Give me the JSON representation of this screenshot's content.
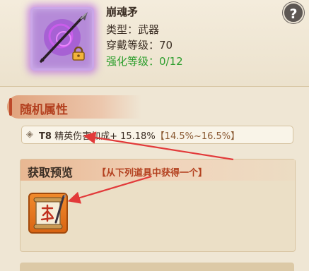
{
  "item": {
    "name": "崩魂矛",
    "type_line": "类型：武器",
    "level_line": "穿戴等级：70",
    "enhance_line": "强化等级：0/12",
    "icon": "spear-icon",
    "locked": true
  },
  "help": {
    "label": "?"
  },
  "random_attr": {
    "title": "随机属性",
    "entry": {
      "tier": "T8",
      "name": "精英伤害加成",
      "value": "+ 15.18%",
      "range": "【14.5%~16.5%】"
    }
  },
  "obtain": {
    "title": "获取预览",
    "subtitle": "【从下列道具中获得一个】",
    "items": [
      {
        "icon": "scroll-icon"
      }
    ]
  },
  "colors": {
    "accent": "#b3401f",
    "enhance_green": "#2d9e2d",
    "epic_purple": "#b58ad8",
    "annotation_arrow": "#e23a3a"
  }
}
